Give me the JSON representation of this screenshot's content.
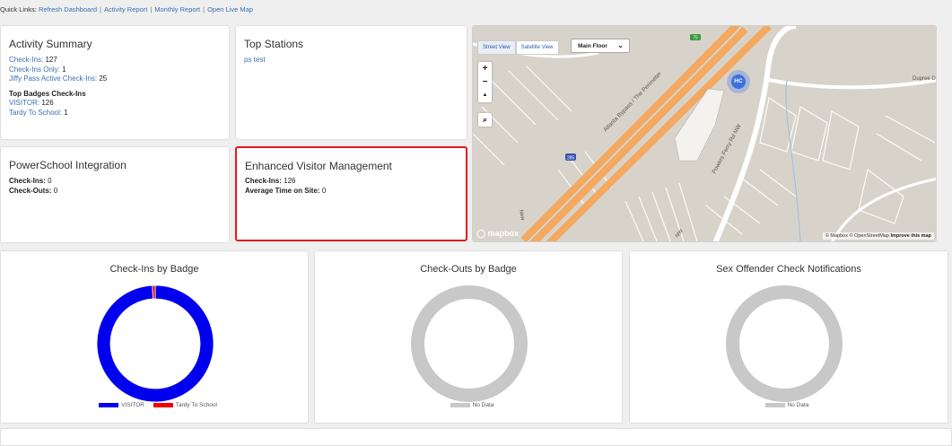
{
  "quick_links": {
    "prefix": "Quick Links:",
    "items": [
      "Refresh Dashboard",
      "Activity Report",
      "Monthly Report",
      "Open Live Map"
    ],
    "separator": "|"
  },
  "activity_summary": {
    "title": "Activity Summary",
    "checkins_label": "Check-Ins:",
    "checkins_value": "127",
    "checkins_only_label": "Check-Ins Only:",
    "checkins_only_value": "1",
    "jiffy_label": "Jiffy Pass Active Check-Ins:",
    "jiffy_value": "25",
    "top_badges_heading": "Top Badges Check-Ins",
    "visitor_label": "VISITOR:",
    "visitor_value": "126",
    "tardy_label": "Tardy To School:",
    "tardy_value": "1"
  },
  "top_stations": {
    "title": "Top Stations",
    "items": [
      "ps test"
    ]
  },
  "powerschool": {
    "title": "PowerSchool Integration",
    "checkins_label": "Check-Ins:",
    "checkins_value": "0",
    "checkouts_label": "Check-Outs:",
    "checkouts_value": "0"
  },
  "evm": {
    "title": "Enhanced Visitor Management",
    "checkins_label": "Check-Ins:",
    "checkins_value": "126",
    "avg_label": "Average Time on Site:",
    "avg_value": "0",
    "highlight_color": "#e0191f"
  },
  "map": {
    "tabs": [
      "Street View",
      "Satellite View"
    ],
    "active_tab": "Street View",
    "floor": "Main Floor",
    "zoom_in": "+",
    "zoom_out": "−",
    "compass": "▲",
    "search": "⌕",
    "marker": "HC",
    "logo": "mapbox",
    "attribution_left": "© Mapbox © OpenStreetMap",
    "attribution_link": "Improve this map",
    "labels": {
      "highway": "Atlanta Bypass / The Perimeter",
      "road": "Powers Ferry Rd NW",
      "road2": "Dupree D",
      "new": "New",
      "nw": "NW",
      "shield1": "285",
      "shield2": "75"
    }
  },
  "chart_data": [
    {
      "type": "pie",
      "title": "Check-Ins by Badge",
      "categories": [
        "VISITOR",
        "Tardy To School"
      ],
      "values": [
        126,
        1
      ],
      "colors": [
        "#0000ee",
        "#ee0000"
      ]
    },
    {
      "type": "pie",
      "title": "Check-Outs by Badge",
      "categories": [
        "No Data"
      ],
      "values": [
        1
      ],
      "colors": [
        "#c8c8c8"
      ]
    },
    {
      "type": "pie",
      "title": "Sex Offender Check Notifications",
      "categories": [
        "No Data"
      ],
      "values": [
        1
      ],
      "colors": [
        "#c8c8c8"
      ]
    }
  ]
}
